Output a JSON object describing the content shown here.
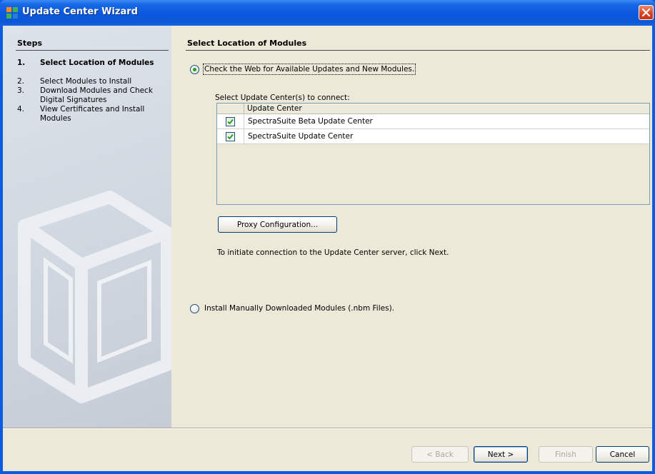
{
  "window": {
    "title": "Update Center Wizard",
    "icon": "netbeans-icon",
    "close_icon": "close-icon"
  },
  "steps": {
    "header": "Steps",
    "items": [
      {
        "num": "1.",
        "label": "Select Location of Modules",
        "active": true
      },
      {
        "num": "2.",
        "label": "Select Modules to Install",
        "active": false
      },
      {
        "num": "3.",
        "label": "Download Modules and Check Digital Signatures",
        "active": false
      },
      {
        "num": "4.",
        "label": "View Certificates and Install Modules",
        "active": false
      }
    ]
  },
  "main": {
    "title": "Select Location of Modules",
    "option_web": {
      "label": "Check the Web for Available Updates and New Modules.",
      "selected": true
    },
    "update_centers": {
      "label": "Select Update Center(s) to connect:",
      "column_header": "Update Center",
      "rows": [
        {
          "name": "SpectraSuite Beta Update Center",
          "checked": true
        },
        {
          "name": "SpectraSuite Update Center",
          "checked": true
        }
      ]
    },
    "proxy_button": "Proxy Configuration...",
    "hint": "To initiate connection to the Update Center server, click Next.",
    "option_manual": {
      "label": "Install Manually Downloaded Modules (.nbm Files).",
      "selected": false
    }
  },
  "footer": {
    "back": "< Back",
    "next": "Next >",
    "finish": "Finish",
    "cancel": "Cancel"
  },
  "colors": {
    "titlebar": "#0a58de",
    "dialog_bg": "#ece9d8",
    "radio_dot": "#21a121",
    "check": "#21a121"
  }
}
